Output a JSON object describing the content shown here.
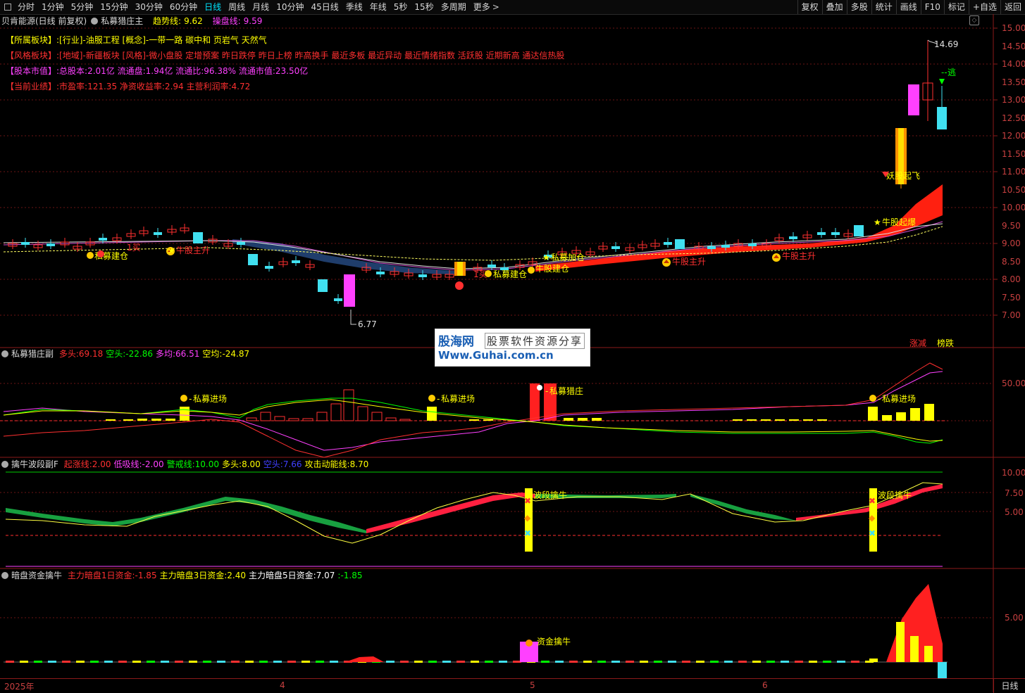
{
  "toolbar": {
    "periods": [
      "分时",
      "1分钟",
      "5分钟",
      "15分钟",
      "30分钟",
      "60分钟",
      "日线",
      "周线",
      "月线",
      "10分钟",
      "45日线",
      "季线",
      "年线",
      "5秒",
      "15秒",
      "多周期",
      "更多"
    ],
    "active_period": "日线",
    "right_buttons": [
      "复权",
      "叠加",
      "多股",
      "统计",
      "画线",
      "F10",
      "标记",
      "+自选",
      "返回"
    ]
  },
  "main_panel": {
    "title": "贝肯能源(日线 前复权)",
    "indicator_name": "私募猎庄主",
    "trend_label": "趋势线:",
    "trend_value": "9.62",
    "control_label": "操盘线:",
    "control_value": "9.59",
    "info_lines": [
      {
        "tag": "【所属板块】:",
        "text": "[行业]-油服工程 [概念]-一带一路 碳中和 页岩气 天然气",
        "tag_color": "#ffff00",
        "text_color": "#ffff00"
      },
      {
        "tag": "【风格板块】:",
        "text": "[地域]-新疆板块 [风格]-微小盘股 定增预案 昨日跌停 昨日上榜 昨高换手 最近多板 最近异动 最近情绪指数 活跃股 近期新高 通达信热股",
        "tag_color": "#ff3030",
        "text_color": "#ff3030"
      },
      {
        "tag": "【股本市值】:",
        "text": "总股本:2.01亿 流通盘:1.94亿 流通比:96.38% 流通市值:23.50亿",
        "tag_color": "#ff40ff",
        "text_color": "#ff40ff"
      },
      {
        "tag": "【当前业绩】:",
        "text": "市盈率:121.35 净资收益率:2.94 主营利润率:4.72",
        "tag_color": "#ff3030",
        "text_color": "#ff3030"
      }
    ],
    "y_ticks": [
      "15.00",
      "14.50",
      "14.00",
      "13.50",
      "13.00",
      "12.50",
      "12.00",
      "11.50",
      "11.00",
      "10.50",
      "10.00",
      "9.50",
      "9.00",
      "8.50",
      "8.00",
      "7.50",
      "7.00"
    ],
    "high_label": "14.69",
    "low_label": "6.77",
    "annotations": [
      "私募建仓",
      "1买",
      "牛股主升",
      "私募建仓",
      "私募加仓",
      "牛股建仓",
      "牛股主升",
      "牛股主升",
      "牛股起爆",
      "妖股起飞",
      "逃",
      "1买"
    ],
    "rank_labels": [
      "涨减",
      "榜跌"
    ]
  },
  "panel2": {
    "name": "私募猎庄副",
    "fields": [
      {
        "label": "多头:",
        "value": "69.18",
        "color": "#ff3030"
      },
      {
        "label": "空头:",
        "value": "-22.86",
        "color": "#00ff00"
      },
      {
        "label": "多均:",
        "value": "66.51",
        "color": "#ff40ff"
      },
      {
        "label": "空均:",
        "value": "-24.87",
        "color": "#ffff00"
      }
    ],
    "y_tick": "50.00",
    "annotations": [
      "私募进场",
      "私募进场",
      "私募猎庄",
      "私募进场"
    ]
  },
  "panel3": {
    "name": "擒牛波段副F",
    "fields": [
      {
        "label": "起涨线:",
        "value": "2.00",
        "color": "#ff3030"
      },
      {
        "label": "低吸线:",
        "value": "-2.00",
        "color": "#ff40ff"
      },
      {
        "label": "警戒线:",
        "value": "10.00",
        "color": "#00ff00"
      },
      {
        "label": "多头:",
        "value": "8.00",
        "color": "#ffff00"
      },
      {
        "label": "空头:",
        "value": "7.66",
        "color": "#4040ff"
      },
      {
        "label": "攻击动能线:",
        "value": "8.70",
        "color": "#ffff00"
      }
    ],
    "y_ticks": [
      "10.00",
      "7.50",
      "5.00"
    ],
    "annotations": [
      "波段擒牛",
      "波段擒牛"
    ]
  },
  "panel4": {
    "name": "暗盘资金擒牛",
    "fields": [
      {
        "label": "主力暗盘1日资金:",
        "value": "-1.85",
        "color": "#ff3030"
      },
      {
        "label": "主力暗盘3日资金:",
        "value": "2.40",
        "color": "#ffff00"
      },
      {
        "label": "主力暗盘5日资金:",
        "value": "7.07",
        "color": "#ffffff"
      },
      {
        "label": ":",
        "value": "-1.85",
        "color": "#00ff00"
      }
    ],
    "y_tick": "5.00",
    "annotations": [
      "资金擒牛"
    ]
  },
  "x_axis": {
    "labels": [
      "2025年",
      "4",
      "5",
      "6"
    ],
    "period_label": "日线"
  },
  "watermark": {
    "line1": "股海网",
    "line1b": "股票软件资源分享",
    "line2": "Www.Guhai.com.cn"
  }
}
